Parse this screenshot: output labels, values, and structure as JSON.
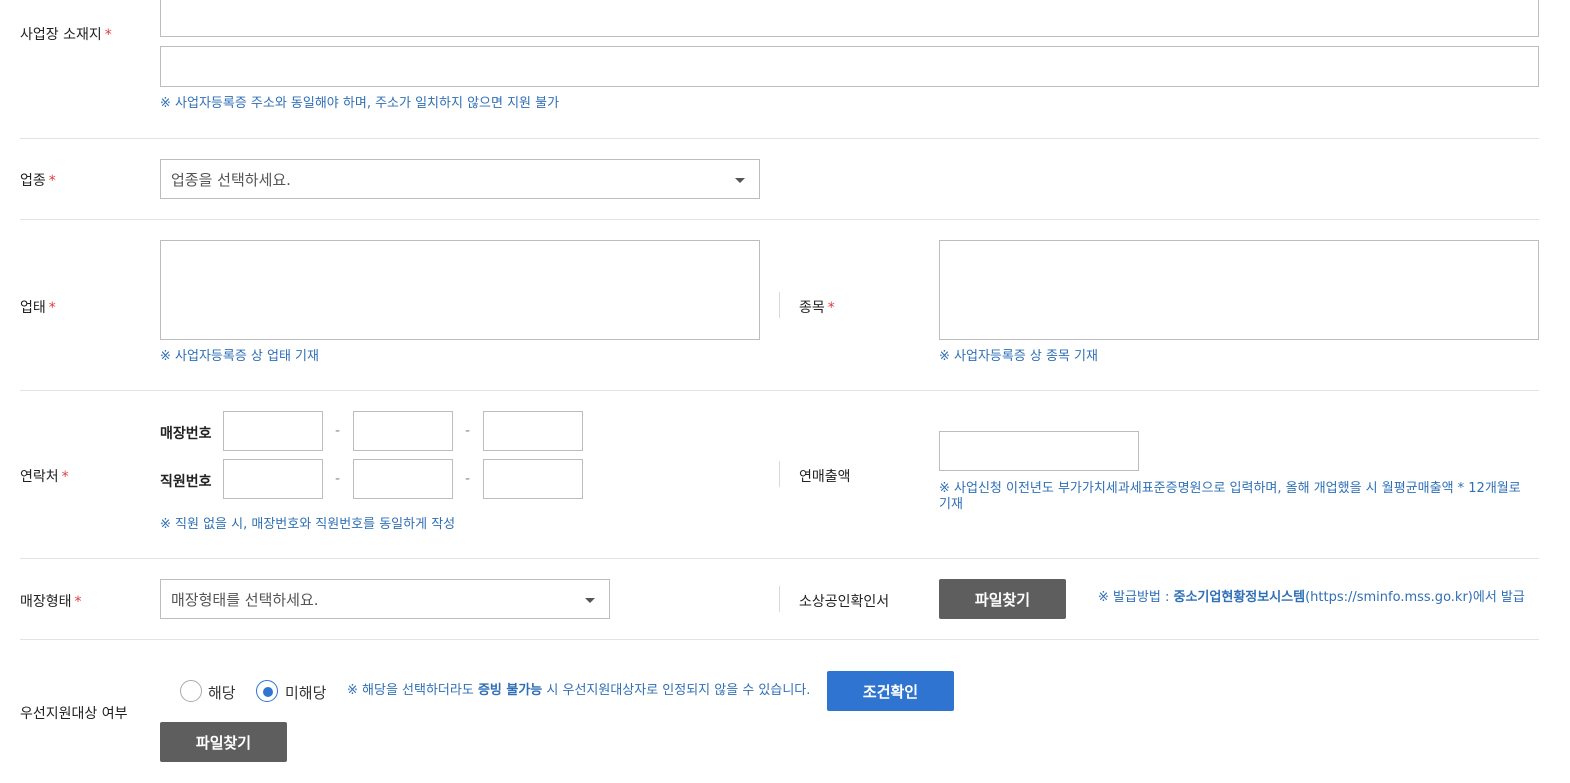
{
  "address": {
    "label": "사업장 소재지",
    "required_mark": "*",
    "line1_value": "",
    "line2_value": "",
    "note": "※ 사업자등록증 주소와 동일해야 하며, 주소가 일치하지 않으면 지원 불가"
  },
  "industry": {
    "label": "업종",
    "required_mark": "*",
    "select_placeholder": "업종을 선택하세요."
  },
  "business_type": {
    "label": "업태",
    "required_mark": "*",
    "value": "",
    "note": "※ 사업자등록증 상 업태 기재"
  },
  "business_item": {
    "label": "종목",
    "required_mark": "*",
    "value": "",
    "note": "※ 사업자등록증 상 종목 기재"
  },
  "contact": {
    "label": "연락처",
    "required_mark": "*",
    "store_phone_label": "매장번호",
    "staff_phone_label": "직원번호",
    "dash": "-",
    "note": "※ 직원 없을 시, 매장번호와 직원번호를 동일하게 작성"
  },
  "annual_sales": {
    "label": "연매출액",
    "value": "",
    "note_line1": "※ 사업신청 이전년도 부가가치세과세표준증명원으로 입력하며, 올해 개업했을 시 월평균매출액 * 12개월로",
    "note_line2": "기재"
  },
  "store_type": {
    "label": "매장형태",
    "required_mark": "*",
    "select_placeholder": "매장형태를 선택하세요."
  },
  "certificate": {
    "label": "소상공인확인서",
    "button_label": "파일찾기",
    "note_prefix": "※ 발급방법 : ",
    "note_bold": "중소기업현황정보시스템",
    "note_suffix": "(https://sminfo.mss.go.kr)에서 발급"
  },
  "priority": {
    "label": "우선지원대상 여부",
    "option_yes": "해당",
    "option_no": "미해당",
    "selected": "미해당",
    "note_prefix": "※ 해당을 선택하더라도 ",
    "note_bold": "증빙 불가능",
    "note_suffix": " 시 우선지원대상자로 인정되지 않을 수 있습니다.",
    "check_button_label": "조건확인",
    "file_button_label": "파일찾기"
  },
  "colors": {
    "accent_blue": "#2f74d0",
    "note_blue": "#2f6fb6",
    "required_red": "#e03a3a",
    "button_gray": "#5e5e5e"
  }
}
